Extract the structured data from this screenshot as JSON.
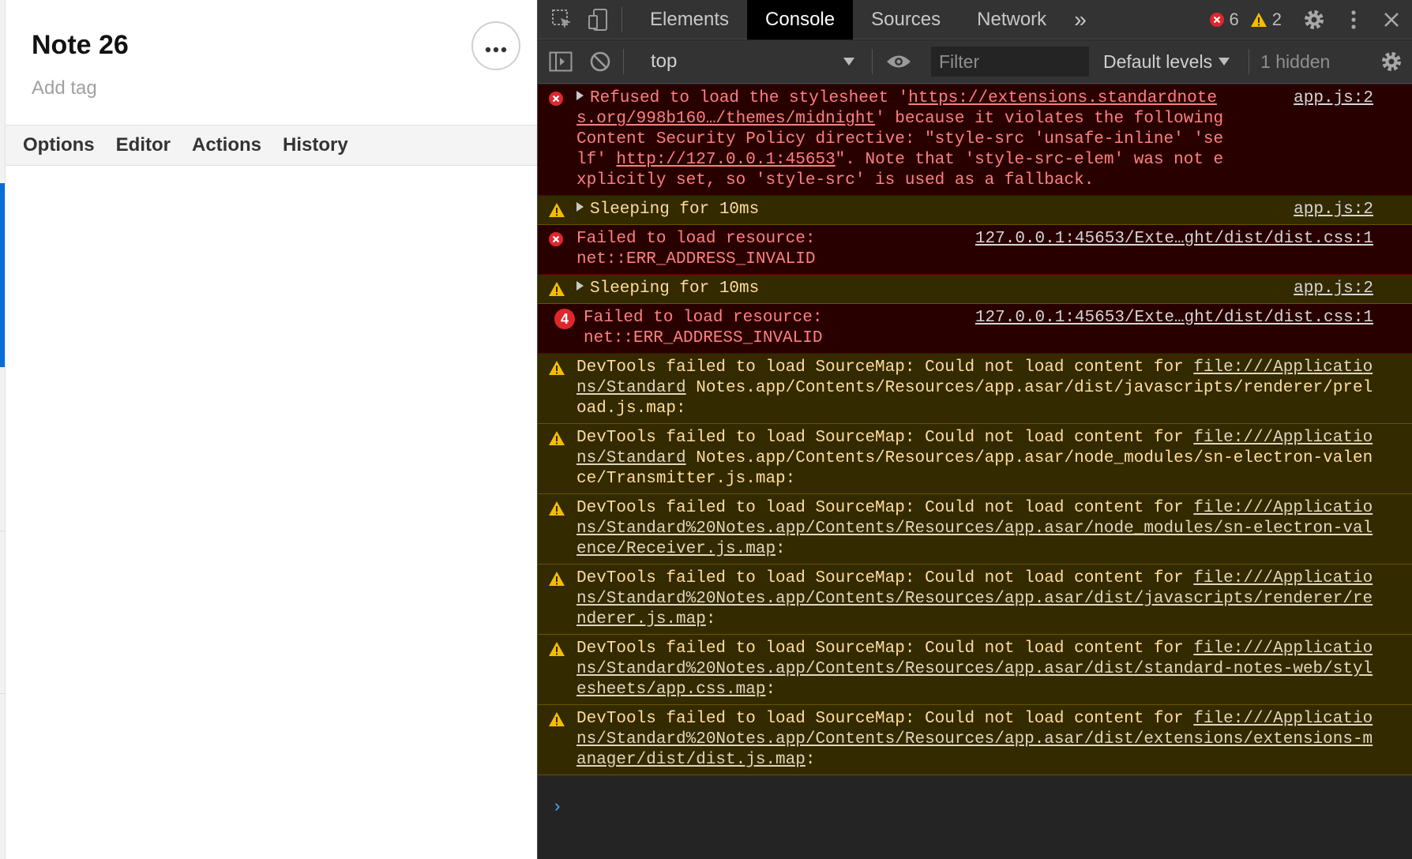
{
  "note": {
    "title": "Note 26",
    "add_tag_placeholder": "Add tag",
    "menu": [
      "Options",
      "Editor",
      "Actions",
      "History"
    ]
  },
  "devtools": {
    "tabs": [
      "Elements",
      "Console",
      "Sources",
      "Network"
    ],
    "active_tab": "Console",
    "more_tabs": "»",
    "error_count": "6",
    "warning_count": "2",
    "context": "top",
    "filter_placeholder": "Filter",
    "levels": "Default levels",
    "hidden": "1 hidden",
    "colors": {
      "error_bg": "#290000",
      "warn_bg": "#332a00",
      "active_tab_bg": "#000000",
      "link_blue": "#4fa3ff"
    }
  },
  "messages": [
    {
      "level": "error",
      "expandable": true,
      "source": "app.js:2",
      "parts": [
        {
          "t": "Refused to load the stylesheet '"
        },
        {
          "t": "https://extensions.standardnotes.org/998b160…/themes/midnight",
          "link": true
        },
        {
          "t": "' because it violates the following Content Security Policy directive: \"style-src 'unsafe-inline' 'self' "
        },
        {
          "t": "http://127.0.0.1:45653",
          "link": true
        },
        {
          "t": "\". Note that 'style-src-elem' was not explicitly set, so 'style-src' is used as a fallback."
        }
      ]
    },
    {
      "level": "warn",
      "expandable": true,
      "source": "app.js:2",
      "parts": [
        {
          "t": "Sleeping for 10ms"
        }
      ]
    },
    {
      "level": "error",
      "expandable": false,
      "source": "127.0.0.1:45653/Exte…ght/dist/dist.css:1",
      "parts": [
        {
          "t": "Failed to load resource:\nnet::ERR_ADDRESS_INVALID"
        }
      ]
    },
    {
      "level": "warn",
      "expandable": true,
      "source": "app.js:2",
      "parts": [
        {
          "t": "Sleeping for 10ms"
        }
      ]
    },
    {
      "level": "error",
      "expandable": false,
      "repeat": "4",
      "source": "127.0.0.1:45653/Exte…ght/dist/dist.css:1",
      "parts": [
        {
          "t": "Failed to load resource:\nnet::ERR_ADDRESS_INVALID"
        }
      ]
    },
    {
      "level": "warn",
      "expandable": false,
      "parts": [
        {
          "t": "DevTools failed to load SourceMap: Could not load content for "
        },
        {
          "t": "file:///Applications/Standard",
          "link": true
        },
        {
          "t": " Notes.app/Contents/Resources/app.asar/dist/javascripts/renderer/preload.js.map:"
        }
      ]
    },
    {
      "level": "warn",
      "expandable": false,
      "parts": [
        {
          "t": "DevTools failed to load SourceMap: Could not load content for "
        },
        {
          "t": "file:///Applications/Standard",
          "link": true
        },
        {
          "t": " Notes.app/Contents/Resources/app.asar/node_modules/sn-electron-valence/Transmitter.js.map:"
        }
      ]
    },
    {
      "level": "warn",
      "expandable": false,
      "parts": [
        {
          "t": "DevTools failed to load SourceMap: Could not load content for "
        },
        {
          "t": "file:///Applications/Standard%20Notes.app/Contents/Resources/app.asar/node_modules/sn-electron-valence/Receiver.js.map",
          "link": true
        },
        {
          "t": ":"
        }
      ]
    },
    {
      "level": "warn",
      "expandable": false,
      "parts": [
        {
          "t": "DevTools failed to load SourceMap: Could not load content for "
        },
        {
          "t": "file:///Applications/Standard%20Notes.app/Contents/Resources/app.asar/dist/javascripts/renderer/renderer.js.map",
          "link": true
        },
        {
          "t": ":"
        }
      ]
    },
    {
      "level": "warn",
      "expandable": false,
      "parts": [
        {
          "t": "DevTools failed to load SourceMap: Could not load content for "
        },
        {
          "t": "file:///Applications/Standard%20Notes.app/Contents/Resources/app.asar/dist/standard-notes-web/stylesheets/app.css.map",
          "link": true
        },
        {
          "t": ":"
        }
      ]
    },
    {
      "level": "warn",
      "expandable": false,
      "parts": [
        {
          "t": "DevTools failed to load SourceMap: Could not load content for "
        },
        {
          "t": "file:///Applications/Standard%20Notes.app/Contents/Resources/app.asar/dist/extensions/extensions-manager/dist/dist.js.map",
          "link": true
        },
        {
          "t": ":"
        }
      ]
    }
  ],
  "prompt_symbol": "›"
}
